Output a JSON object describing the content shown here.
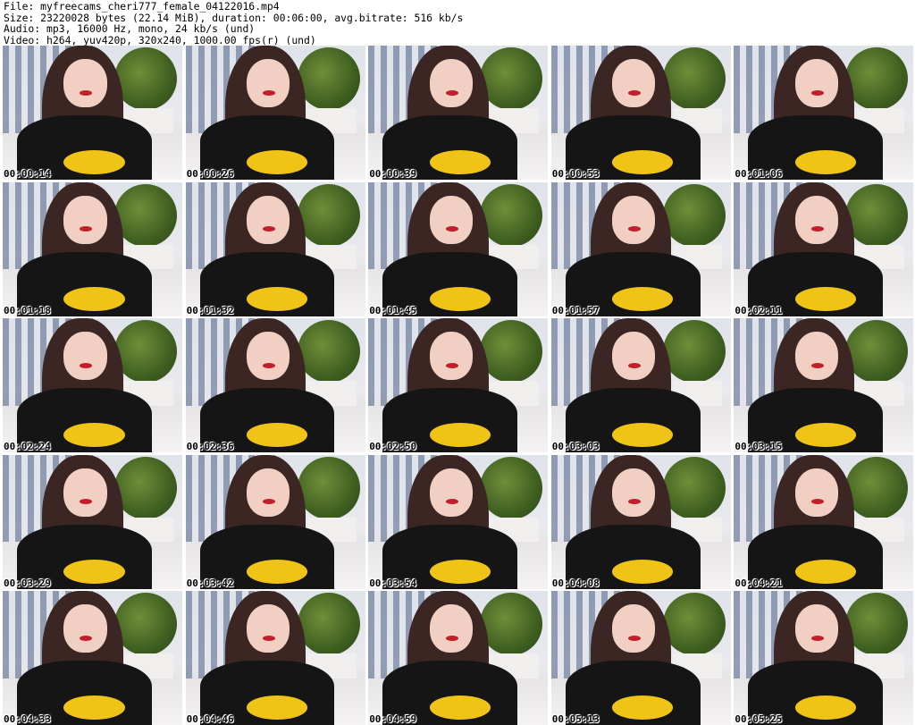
{
  "header": {
    "file_line": "File: myfreecams_cheri777_female_04122016.mp4",
    "size_line": "Size: 23220028 bytes (22.14 MiB), duration: 00:06:00, avg.bitrate: 516 kb/s",
    "audio_line": "Audio: mp3, 16000 Hz, mono, 24 kb/s (und)",
    "video_line": "Video: h264, yuv420p, 320x240, 1000.00 fps(r) (und)"
  },
  "thumbnails": [
    {
      "timestamp": "00:00:14"
    },
    {
      "timestamp": "00:00:26"
    },
    {
      "timestamp": "00:00:39"
    },
    {
      "timestamp": "00:00:53"
    },
    {
      "timestamp": "00:01:06"
    },
    {
      "timestamp": "00:01:18"
    },
    {
      "timestamp": "00:01:32"
    },
    {
      "timestamp": "00:01:45"
    },
    {
      "timestamp": "00:01:57"
    },
    {
      "timestamp": "00:02:11"
    },
    {
      "timestamp": "00:02:24"
    },
    {
      "timestamp": "00:02:36"
    },
    {
      "timestamp": "00:02:50"
    },
    {
      "timestamp": "00:03:03"
    },
    {
      "timestamp": "00:03:15"
    },
    {
      "timestamp": "00:03:29"
    },
    {
      "timestamp": "00:03:42"
    },
    {
      "timestamp": "00:03:54"
    },
    {
      "timestamp": "00:04:08"
    },
    {
      "timestamp": "00:04:21"
    },
    {
      "timestamp": "00:04:33"
    },
    {
      "timestamp": "00:04:46"
    },
    {
      "timestamp": "00:04:59"
    },
    {
      "timestamp": "00:05:13"
    },
    {
      "timestamp": "00:05:25"
    }
  ]
}
